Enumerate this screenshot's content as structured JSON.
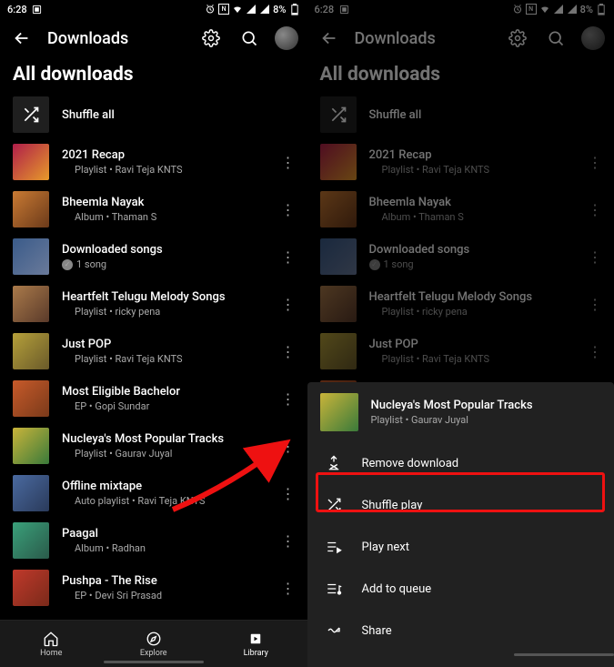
{
  "statusbar": {
    "time": "6:28",
    "battery": "8%"
  },
  "appbar": {
    "title": "Downloads"
  },
  "section_title": "All downloads",
  "shuffle_label": "Shuffle all",
  "items": [
    {
      "title": "2021 Recap",
      "subtitle": "Playlist • Ravi Teja KNTS"
    },
    {
      "title": "Bheemla Nayak",
      "subtitle": "Album • Thaman S"
    },
    {
      "title": "Downloaded songs",
      "subtitle": "1 song"
    },
    {
      "title": "Heartfelt Telugu Melody Songs",
      "subtitle": "Playlist • ricky pena"
    },
    {
      "title": "Just POP",
      "subtitle": "Playlist • Ravi Teja KNTS"
    },
    {
      "title": "Most Eligible Bachelor",
      "subtitle": "EP • Gopi Sundar"
    },
    {
      "title": "Nucleya's Most Popular Tracks",
      "subtitle": "Playlist • Gaurav Juyal"
    },
    {
      "title": "Offline mixtape",
      "subtitle": "Auto playlist • Ravi Teja KNTS"
    },
    {
      "title": "Paagal",
      "subtitle": "Album • Radhan"
    },
    {
      "title": "Pushpa - The Rise",
      "subtitle": "EP • Devi Sri Prasad"
    }
  ],
  "bottomnav": {
    "home": "Home",
    "explore": "Explore",
    "library": "Library"
  },
  "sheet": {
    "title": "Nucleya's Most Popular Tracks",
    "subtitle": "Playlist • Gaurav Juyal",
    "actions": {
      "remove": "Remove download",
      "shuffle": "Shuffle play",
      "play_next": "Play next",
      "add_queue": "Add to queue",
      "share": "Share"
    }
  }
}
